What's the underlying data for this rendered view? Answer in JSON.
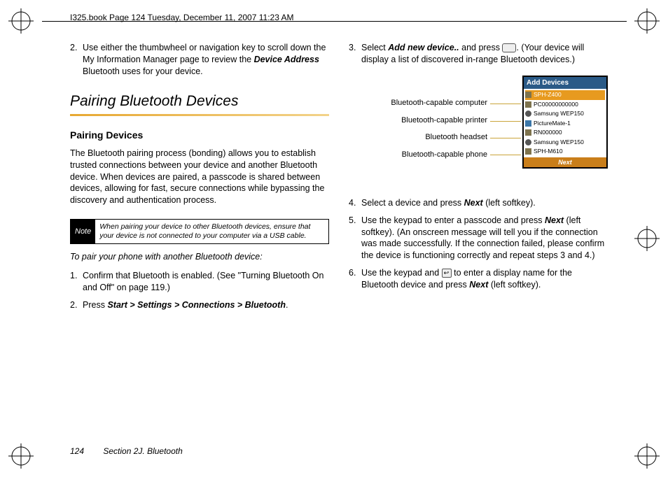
{
  "header": "I325.book  Page 124  Tuesday, December 11, 2007  11:23 AM",
  "col1": {
    "step2_a": "2.",
    "step2_b": "Use either the thumbwheel or navigation key to scroll down the My Information Manager page to review the ",
    "step2_em": "Device Address",
    "step2_c": " Bluetooth uses for your device.",
    "h2": "Pairing Bluetooth Devices",
    "h3": "Pairing Devices",
    "para1": "The Bluetooth pairing process (bonding) allows you to establish trusted connections between your device and another Bluetooth device. When devices are paired, a passcode is shared between devices, allowing for fast, secure connections while bypassing the discovery and authentication process.",
    "note_label": "Note",
    "note_text": "When pairing your device to other Bluetooth devices, ensure that your device is not connected to your computer via a USB cable.",
    "instr": "To pair your phone with another Bluetooth device:",
    "s1n": "1.",
    "s1t": "Confirm that Bluetooth is enabled. (See \"Turning Bluetooth On and Off\" on page 119.)",
    "s2n": "2.",
    "s2a": "Press ",
    "s2em": "Start > Settings > Connections > Bluetooth",
    "s2b": "."
  },
  "col2": {
    "s3n": "3.",
    "s3a": "Select ",
    "s3em": "Add new device..",
    "s3b": " and press ",
    "s3c": ". (Your device will display a list of discovered in-range Bluetooth devices.)",
    "labels": {
      "l1": "Bluetooth-capable computer",
      "l2": "Bluetooth-capable printer",
      "l3": "Bluetooth headset",
      "l4": "Bluetooth-capable phone"
    },
    "device": {
      "title": "Add Devices",
      "items": [
        "SPH-Z400",
        "PC00000000000",
        "Samsung WEP150",
        "PictureMate-1",
        "RN000000",
        "Samsung WEP150",
        "SPH-M610"
      ],
      "next": "Next"
    },
    "s4n": "4.",
    "s4a": "Select a device and press ",
    "s4em": "Next",
    "s4b": " (left softkey).",
    "s5n": "5.",
    "s5a": "Use the keypad to enter a passcode and press ",
    "s5em": "Next",
    "s5b": " (left softkey). (An onscreen message will tell you if the connection was made successfully. If the connection failed, please confirm the device is functioning correctly and repeat steps 3 and 4.)",
    "s6n": "6.",
    "s6a": "Use the keypad and ",
    "s6b": " to enter a display name for the Bluetooth device and press ",
    "s6em": "Next",
    "s6c": " (left softkey)."
  },
  "footer": {
    "page": "124",
    "section": "Section 2J. Bluetooth"
  }
}
